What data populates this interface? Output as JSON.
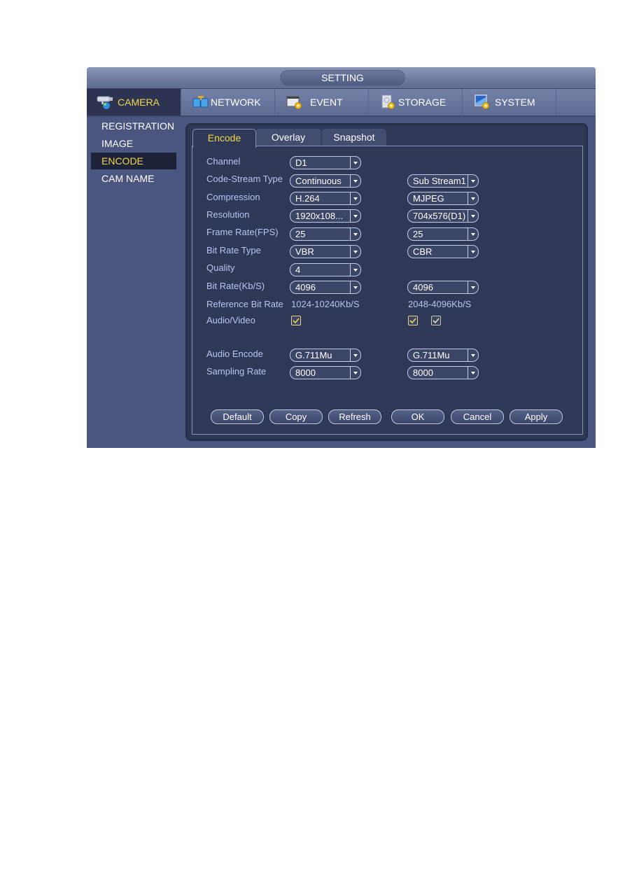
{
  "window": {
    "title": "SETTING"
  },
  "topnav": [
    {
      "label": "CAMERA",
      "icon": "camera-icon",
      "active": true
    },
    {
      "label": "NETWORK",
      "icon": "network-icon",
      "active": false
    },
    {
      "label": "EVENT",
      "icon": "event-icon",
      "active": false
    },
    {
      "label": "STORAGE",
      "icon": "storage-icon",
      "active": false
    },
    {
      "label": "SYSTEM",
      "icon": "system-icon",
      "active": false
    }
  ],
  "sidebar": [
    {
      "label": "REGISTRATION",
      "active": false
    },
    {
      "label": "IMAGE",
      "active": false
    },
    {
      "label": "ENCODE",
      "active": true
    },
    {
      "label": "CAM NAME",
      "active": false
    }
  ],
  "tabs": [
    {
      "label": "Encode",
      "active": true
    },
    {
      "label": "Overlay",
      "active": false
    },
    {
      "label": "Snapshot",
      "active": false
    }
  ],
  "form": {
    "channel": {
      "label": "Channel",
      "value": "D1"
    },
    "code_stream_type": {
      "label": "Code-Stream Type",
      "main": "Continuous",
      "sub": "Sub Stream1"
    },
    "compression": {
      "label": "Compression",
      "main": "H.264",
      "sub": "MJPEG"
    },
    "resolution": {
      "label": "Resolution",
      "main": "1920x108...",
      "sub": "704x576(D1)"
    },
    "frame_rate": {
      "label": "Frame Rate(FPS)",
      "main": "25",
      "sub": "25"
    },
    "bit_rate_type": {
      "label": "Bit Rate Type",
      "main": "VBR",
      "sub": "CBR"
    },
    "quality": {
      "label": "Quality",
      "main": "4"
    },
    "bit_rate": {
      "label": "Bit Rate(Kb/S)",
      "main": "4096",
      "sub": "4096"
    },
    "reference_bit_rate": {
      "label": "Reference Bit Rate",
      "main": "1024-10240Kb/S",
      "sub": "2048-4096Kb/S"
    },
    "audio_video": {
      "label": "Audio/Video",
      "main_checked": true,
      "sub_audio_checked": true,
      "sub_video_checked": true
    },
    "audio_encode": {
      "label": "Audio Encode",
      "main": "G.711Mu",
      "sub": "G.711Mu"
    },
    "sampling_rate": {
      "label": "Sampling Rate",
      "main": "8000",
      "sub": "8000"
    }
  },
  "buttons": {
    "default": "Default",
    "copy": "Copy",
    "refresh": "Refresh",
    "ok": "OK",
    "cancel": "Cancel",
    "apply": "Apply"
  }
}
